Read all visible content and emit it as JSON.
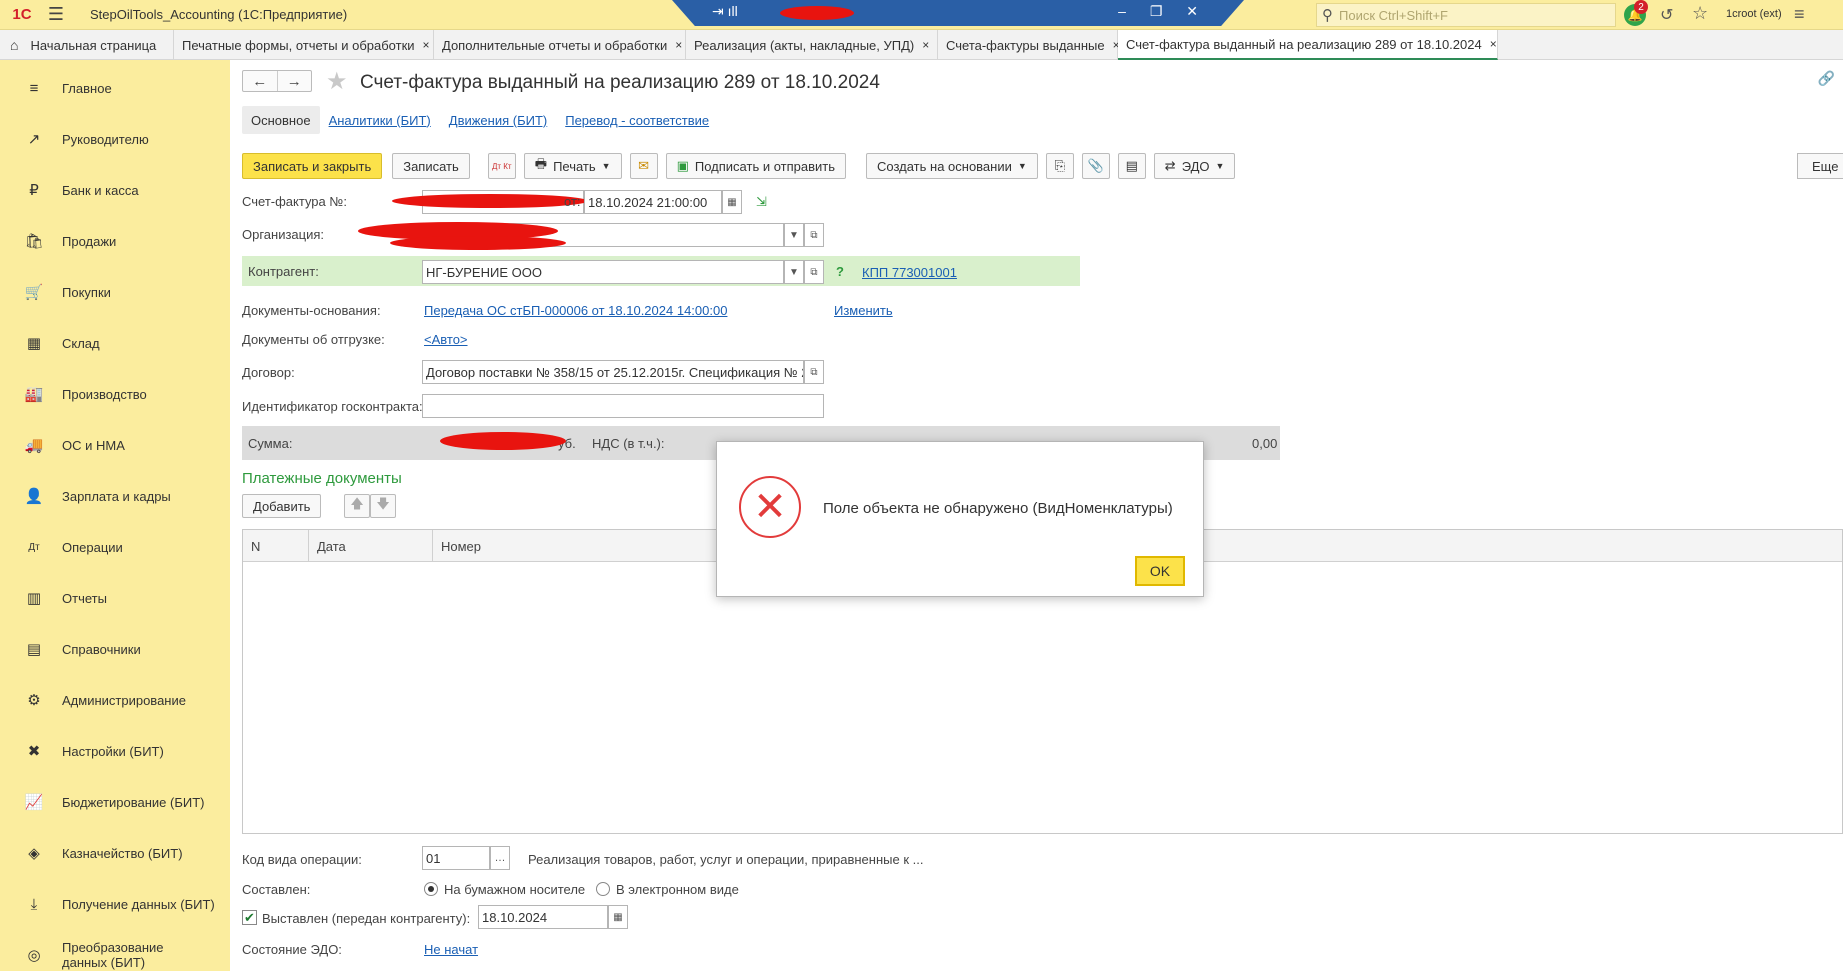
{
  "titlebar": {
    "logo": "1С",
    "app_title": "StepOilTools_Accounting   (1С:Предприятие)",
    "remote_left": "⇥ ıll",
    "remote_controls": "‒ ❐ ✕",
    "search_placeholder": "Поиск Ctrl+Shift+F",
    "notifications_count": "2",
    "user": "1croot (ext)"
  },
  "tabs": [
    {
      "label": "Начальная страница"
    },
    {
      "label": "Печатные формы, отчеты и обработки"
    },
    {
      "label": "Дополнительные отчеты и обработки"
    },
    {
      "label": "Реализация (акты, накладные, УПД)"
    },
    {
      "label": "Счета-фактуры выданные"
    },
    {
      "label": "Счет-фактура выданный на реализацию 289 от 18.10.2024"
    }
  ],
  "tab_close": "×",
  "sidebar": [
    {
      "label": "Главное",
      "icon": "≡"
    },
    {
      "label": "Руководителю",
      "icon": "↗"
    },
    {
      "label": "Банк и касса",
      "icon": "₽"
    },
    {
      "label": "Продажи",
      "icon": "🛍"
    },
    {
      "label": "Покупки",
      "icon": "🛒"
    },
    {
      "label": "Склад",
      "icon": "▦"
    },
    {
      "label": "Производство",
      "icon": "🏭"
    },
    {
      "label": "ОС и НМА",
      "icon": "🚚"
    },
    {
      "label": "Зарплата и кадры",
      "icon": "👤"
    },
    {
      "label": "Операции",
      "icon": "Дт"
    },
    {
      "label": "Отчеты",
      "icon": "▥"
    },
    {
      "label": "Справочники",
      "icon": "▤"
    },
    {
      "label": "Администрирование",
      "icon": "⚙"
    },
    {
      "label": "Настройки (БИТ)",
      "icon": "✖"
    },
    {
      "label": "Бюджетирование (БИТ)",
      "icon": "📈"
    },
    {
      "label": "Казначейство (БИТ)",
      "icon": "◈"
    },
    {
      "label": "Получение данных (БИТ)",
      "icon": "⤓"
    },
    {
      "label": "Преобразование данных (БИТ)",
      "icon": "◎"
    }
  ],
  "document": {
    "title": "Счет-фактура выданный на реализацию 289 от 18.10.2024",
    "subtabs": [
      "Основное",
      "Аналитики (БИТ)",
      "Движения (БИТ)",
      "Перевод - соответствие"
    ],
    "toolbar": {
      "save_close": "Записать и закрыть",
      "save": "Записать",
      "dtkt": "Дт Кт",
      "print": "Печать",
      "sign_send": "Подписать и отправить",
      "create_based": "Создать на основании",
      "edo": "ЭДО",
      "more": "Еще"
    },
    "fields": {
      "invoice_no_label": "Счет-фактура №:",
      "date_label": "от:",
      "date_value": "18.10.2024 21:00:00",
      "org_label": "Организация:",
      "counterparty_label": "Контрагент:",
      "counterparty_value": "НГ-БУРЕНИЕ ООО",
      "question": "?",
      "kpp": "КПП 773001001",
      "base_docs_label": "Документы-основания:",
      "base_docs_value": "Передача ОС стБП-000006 от 18.10.2024 14:00:00",
      "change": "Изменить",
      "shipment_docs_label": "Документы об отгрузке:",
      "shipment_docs_value": "<Авто>",
      "contract_label": "Договор:",
      "contract_value": "Договор поставки № 358/15 от 25.12.2015г. Спецификация № 2",
      "gov_id_label": "Идентификатор госконтракта:",
      "sum_label": "Сумма:",
      "sum_currency": "уб.",
      "vat_label": "НДС (в т.ч.):",
      "total_value": "0,00"
    },
    "payments": {
      "title": "Платежные документы",
      "add": "Добавить",
      "columns": [
        "N",
        "Дата",
        "Номер"
      ]
    },
    "bottom": {
      "op_code_label": "Код вида операции:",
      "op_code_value": "01",
      "op_code_desc": "Реализация товаров, работ, услуг и операции, приравненные к ...",
      "composed_label": "Составлен:",
      "paper": "На бумажном носителе",
      "electronic": "В электронном виде",
      "issued_label": "Выставлен (передан контрагенту):",
      "issued_date": "18.10.2024",
      "edo_state_label": "Состояние ЭДО:",
      "edo_state_value": "Не начат"
    }
  },
  "dialog": {
    "message": "Поле объекта не обнаружено (ВидНоменклатуры)",
    "ok": "OK"
  },
  "colors": {
    "accent_yellow": "#fbed9e",
    "button_yellow": "#fce24a",
    "error_red": "#e23b3b",
    "link_blue": "#1a5fb4",
    "section_green": "#2e9a3d"
  }
}
